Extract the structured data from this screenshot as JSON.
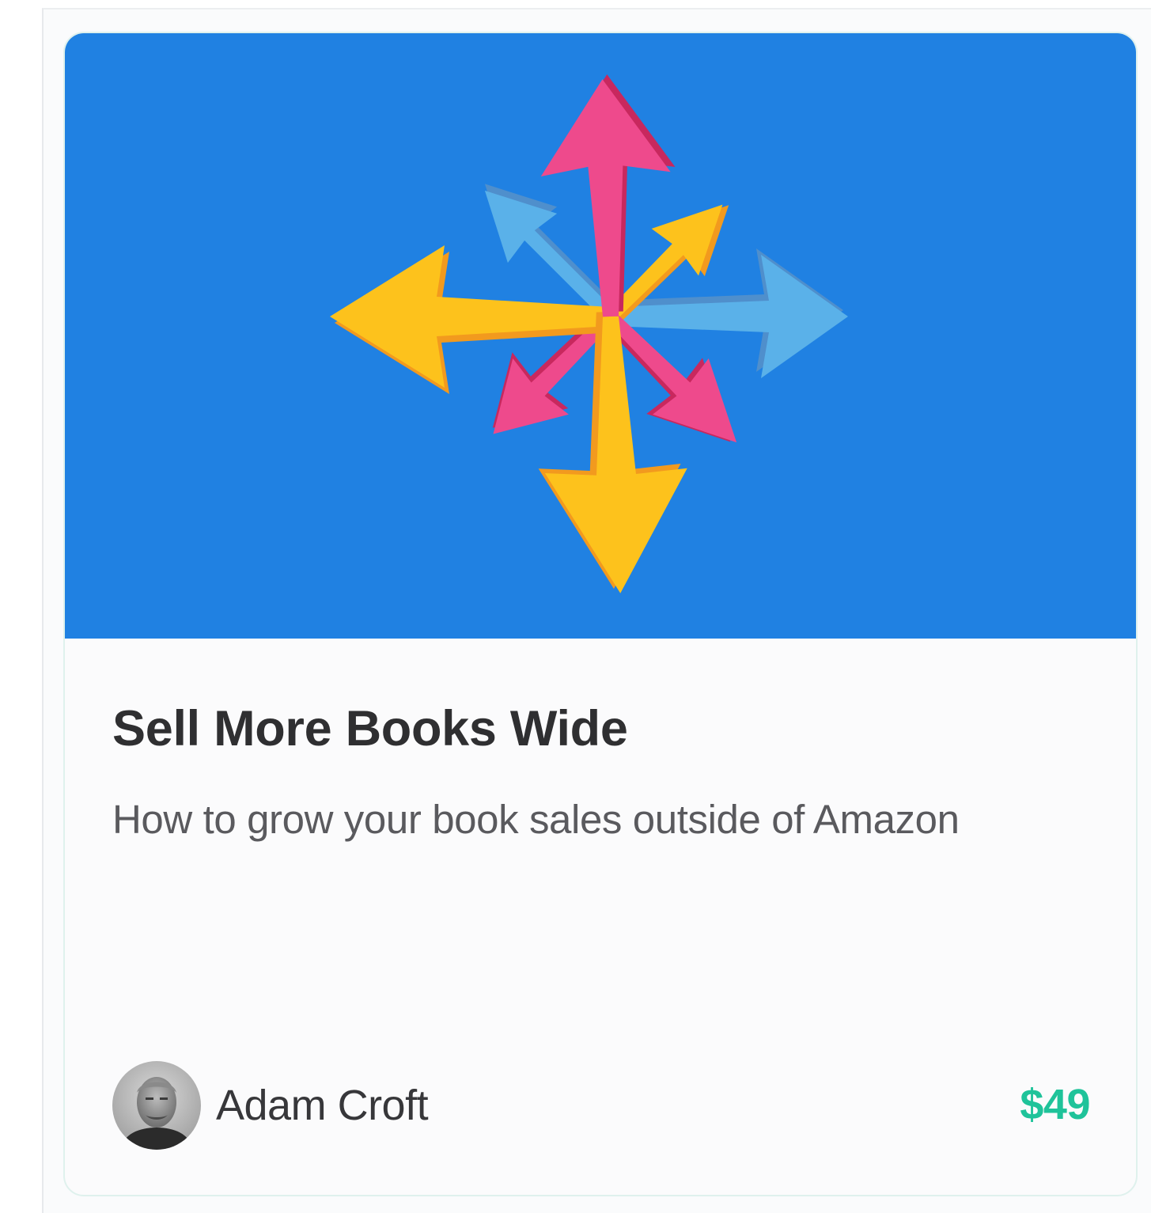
{
  "course_card": {
    "title": "Sell More Books Wide",
    "subtitle": "How to grow your book sales outside of Amazon",
    "author": {
      "name": "Adam Croft",
      "avatar_icon": "author-avatar-photo"
    },
    "price": "$49",
    "hero_icon": "arrows-outward-burst-icon"
  },
  "colors": {
    "hero_background": "#2081e2",
    "price": "#1fc39a",
    "title": "#2f2f31",
    "subtitle": "#5a5a5e",
    "card_border": "#dff1ed",
    "arrow_pink": "#ee4a8c",
    "arrow_yellow": "#fdc21c",
    "arrow_light_blue": "#5ab1e9"
  }
}
